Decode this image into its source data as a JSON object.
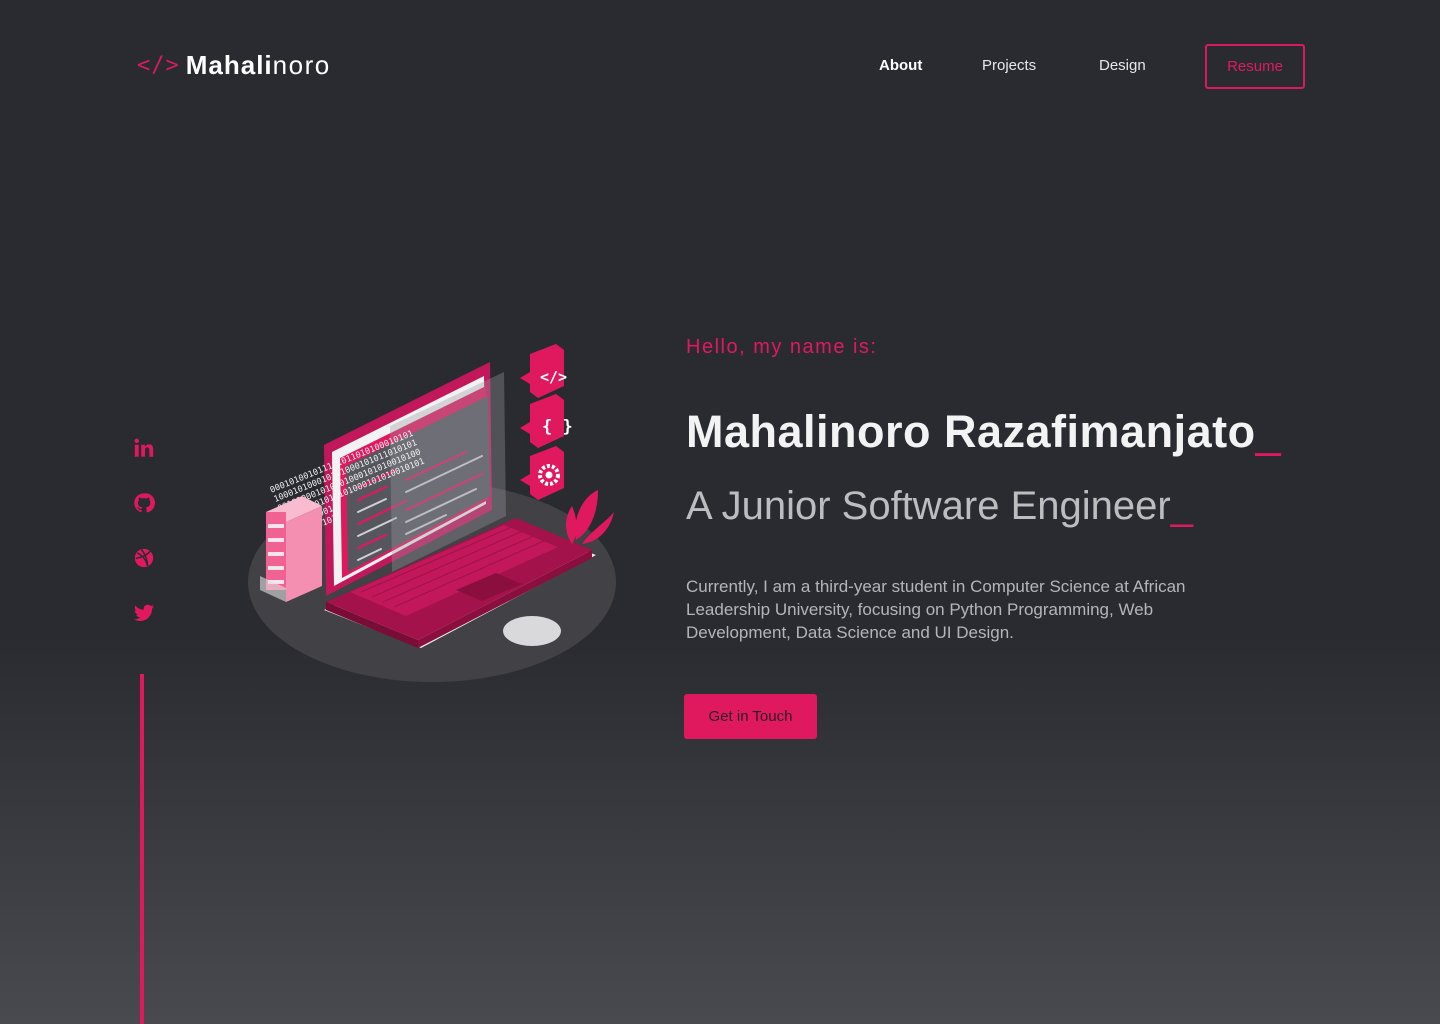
{
  "brand": {
    "mark": "</>",
    "bold": "Mahali",
    "light": "noro"
  },
  "nav": {
    "items": [
      {
        "label": "About"
      },
      {
        "label": "Projects"
      },
      {
        "label": "Design"
      }
    ],
    "resume_label": "Resume"
  },
  "social": [
    {
      "icon": "linkedin-icon"
    },
    {
      "icon": "github-icon"
    },
    {
      "icon": "dribbble-icon"
    },
    {
      "icon": "twitter-icon"
    }
  ],
  "hero": {
    "greeting": "Hello, my name is:",
    "name": "Mahalinoro Razafimanjato",
    "role": "A Junior Software Engineer",
    "cursor": "_",
    "bio": "Currently, I am a third-year student in Computer Science at African Leadership University, focusing on Python Programming, Web Development, Data Science and UI Design.",
    "cta_label": "Get in Touch"
  },
  "illustration": {
    "binary_lines": [
      "000101001011101011010100010101",
      "100010100010101000101011010101",
      "001010001010101000101010010100",
      "011010001010101000101010010101",
      "0001010001",
      "1010100101"
    ],
    "code_tag_icon": "code-icon",
    "braces_icon": "braces-icon",
    "gear_icon": "gear-icon"
  },
  "colors": {
    "accent": "#e0195f",
    "background": "#2a2b31",
    "text_muted": "#b5b5b9"
  }
}
